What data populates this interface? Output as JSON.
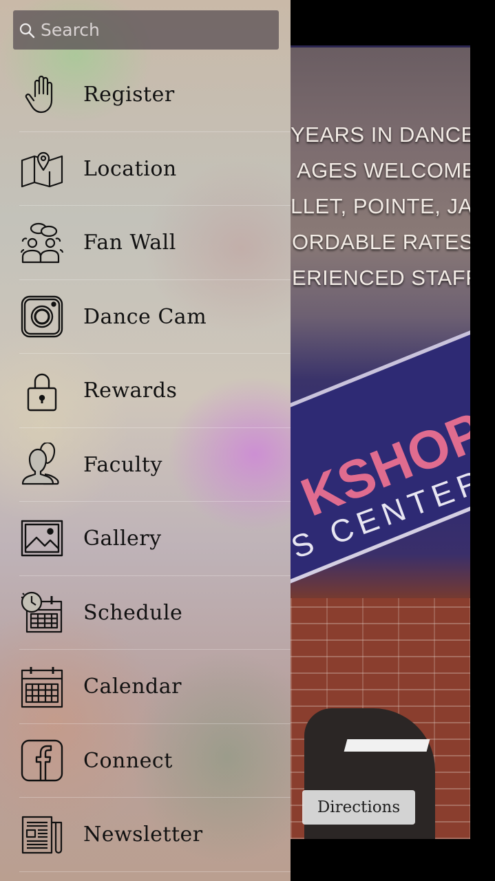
{
  "search": {
    "placeholder": "Search"
  },
  "menu": {
    "items": [
      {
        "label": "Register",
        "icon": "hand-icon"
      },
      {
        "label": "Location",
        "icon": "map-pin-icon"
      },
      {
        "label": "Fan Wall",
        "icon": "people-chat-icon"
      },
      {
        "label": "Dance Cam",
        "icon": "camera-icon"
      },
      {
        "label": "Rewards",
        "icon": "lock-icon"
      },
      {
        "label": "Faculty",
        "icon": "users-icon"
      },
      {
        "label": "Gallery",
        "icon": "image-icon"
      },
      {
        "label": "Schedule",
        "icon": "clock-calendar-icon"
      },
      {
        "label": "Calendar",
        "icon": "calendar-icon"
      },
      {
        "label": "Connect",
        "icon": "facebook-icon"
      },
      {
        "label": "Newsletter",
        "icon": "newspaper-icon"
      }
    ]
  },
  "background": {
    "promo_lines": [
      "YEARS IN DANCE",
      "AGES WELCOME",
      "LLET, POINTE, JAZZ",
      "ORDABLE RATES",
      "ERIENCED STAFF"
    ],
    "sign_word": "KSHOP",
    "sign_sub": "S CENTER",
    "directions_label": "Directions"
  }
}
